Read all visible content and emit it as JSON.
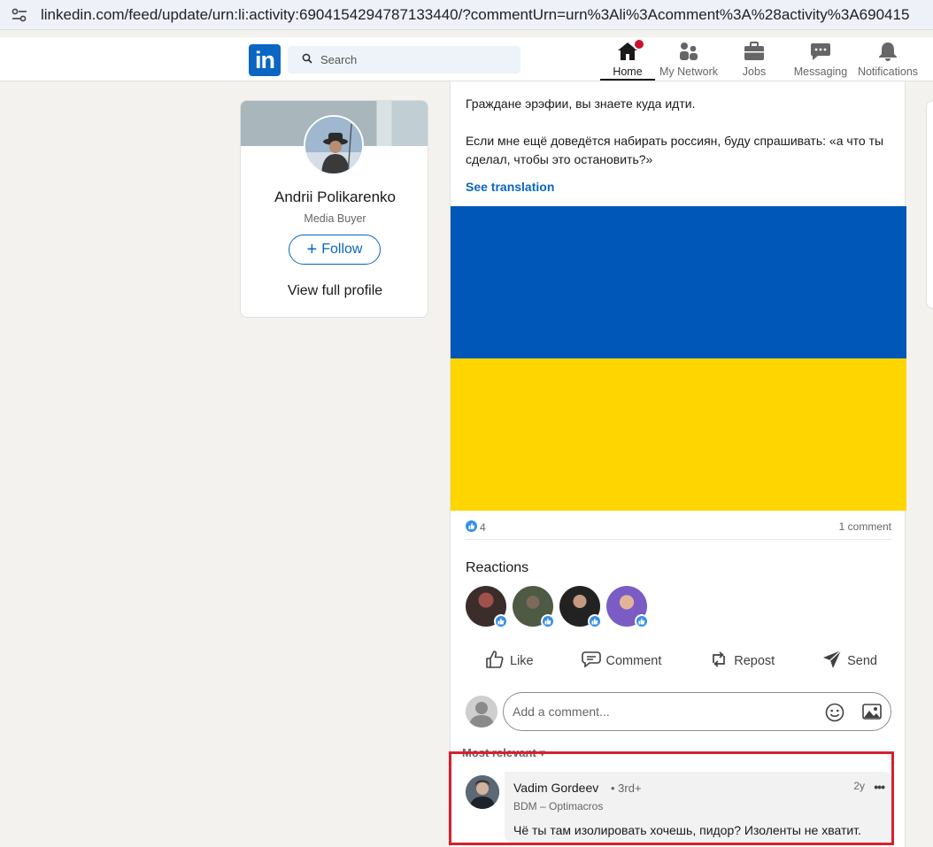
{
  "browser": {
    "url": "linkedin.com/feed/update/urn:li:activity:6904154294787133440/?commentUrn=urn%3Ali%3Acomment%3A%28activity%3A690415"
  },
  "header": {
    "logo": "in",
    "search_placeholder": "Search",
    "nav": [
      {
        "label": "Home",
        "icon": "home-icon",
        "active": true,
        "notification": true
      },
      {
        "label": "My Network",
        "icon": "network-icon"
      },
      {
        "label": "Jobs",
        "icon": "briefcase-icon"
      },
      {
        "label": "Messaging",
        "icon": "message-icon"
      },
      {
        "label": "Notifications",
        "icon": "bell-icon"
      }
    ]
  },
  "profile": {
    "name": "Andrii Polikarenko",
    "headline": "Media Buyer",
    "follow_label": "Follow",
    "view_profile_label": "View full profile"
  },
  "post": {
    "paragraph_1": "Граждане эрэфии, вы знаете куда идти.",
    "paragraph_2": "Если мне ещё доведётся набирать россиян, буду спрашивать: «а что ты сделал, чтобы это остановить?»",
    "see_translation": "See translation",
    "flag_colors": {
      "top": "#0057b7",
      "bottom": "#ffd500"
    },
    "reaction_count": "4",
    "comment_count": "1 comment",
    "reactions_title": "Reactions",
    "actions": {
      "like": "Like",
      "comment": "Comment",
      "repost": "Repost",
      "send": "Send"
    },
    "comment_placeholder": "Add a comment...",
    "sort_label": "Most relevant"
  },
  "comment": {
    "author": "Vadim Gordeev",
    "degree": "• 3rd+",
    "subtitle": "BDM – Optimacros",
    "time": "2y",
    "more": "•••",
    "text": "Чё ты там изолировать хочешь, пидор? Изоленты не хватит."
  },
  "colors": {
    "brand": "#0a66c2",
    "highlight_border": "#d9202e"
  }
}
